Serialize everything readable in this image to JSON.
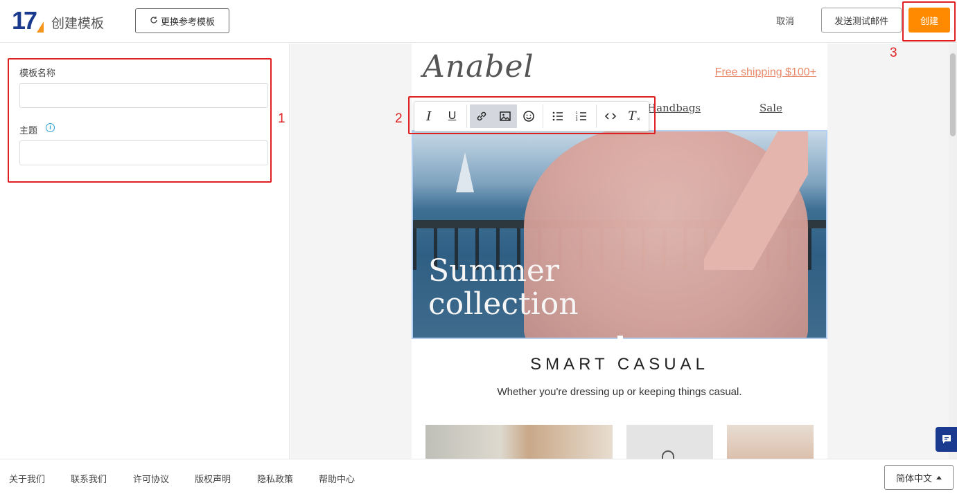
{
  "header": {
    "logo_text": "17",
    "title": "创建模板",
    "switch_template_label": "更换参考模板",
    "cancel_label": "取消",
    "send_test_label": "发送测试邮件",
    "create_label": "创建",
    "accent_color": "#ff8a00"
  },
  "form": {
    "name_label": "模板名称",
    "name_value": "",
    "subject_label": "主题",
    "subject_value": ""
  },
  "annotations": [
    "1",
    "2",
    "3"
  ],
  "email": {
    "brand": "Anabel",
    "shipping": "Free shipping $100+",
    "nav": [
      "Handbags",
      "Sale"
    ],
    "hero_line1": "Summer",
    "hero_line2": "collection",
    "section_title": "SMART CASUAL",
    "section_sub": "Whether you're dressing up or keeping things casual."
  },
  "toolbar": {
    "buttons": [
      "italic-icon",
      "underline-icon",
      "link-icon",
      "image-icon",
      "emoji-icon",
      "bullet-list-icon",
      "numbered-list-icon",
      "code-icon",
      "clear-format-icon"
    ],
    "italic": "I",
    "underline": "U",
    "clear": "T"
  },
  "footer": {
    "links": [
      "关于我们",
      "联系我们",
      "许可协议",
      "版权声明",
      "隐私政策",
      "帮助中心"
    ],
    "language": "简体中文"
  }
}
